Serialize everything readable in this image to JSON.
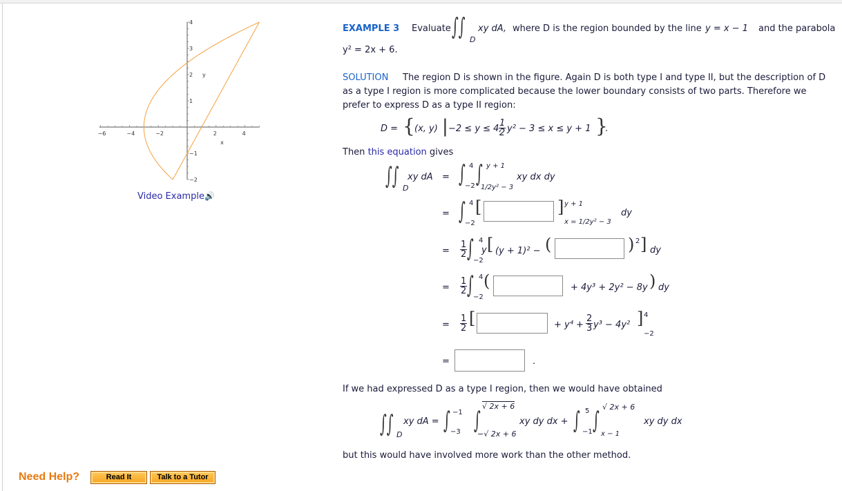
{
  "example": {
    "heading": "EXAMPLE 3",
    "evaluate": "Evaluate",
    "integrand": "xy dA,",
    "region_sub": "D",
    "statement": "where D is the region bounded by the line",
    "line_eq": "y = x − 1",
    "and_parabola": "and the parabola",
    "parabola_eq": "y² = 2x + 6."
  },
  "solution": {
    "heading": "SOLUTION",
    "lines": [
      "The region D is shown in the figure. Again D is both type I and type II, but the description of D",
      "as a type I region is more complicated because the lower boundary consists of two parts. Therefore we",
      "prefer to express D as a type II region:"
    ],
    "set_def": {
      "lhs": "D =",
      "pair": "(x, y)",
      "y_range": "−2 ≤ y ≤ 4,",
      "frac_num": "1",
      "frac_den": "2",
      "x_range": "y² − 3 ≤ x ≤ y + 1",
      "period": "."
    },
    "then": "Then",
    "equation_link": "this equation",
    "gives": "gives"
  },
  "steps": {
    "lhs": "xy dA",
    "lhs_sub": "D",
    "eq": "=",
    "step1": {
      "outer_upper": "4",
      "outer_lower": "−2",
      "inner_upper": "y + 1",
      "inner_lower": "1/2y² − 3",
      "integrand": "xy dx dy"
    },
    "step2": {
      "upper": "4",
      "lower": "−2",
      "eval_upper": "y + 1",
      "eval_lower": "x = 1/2y² − 3",
      "diff": "dy",
      "answer": ""
    },
    "step3": {
      "coef_num": "1",
      "coef_den": "2",
      "upper": "4",
      "lower": "−2",
      "body": "y",
      "expr": "(y + 1)² −",
      "power": "2",
      "diff": "dy",
      "answer": ""
    },
    "step4": {
      "coef_num": "1",
      "coef_den": "2",
      "upper": "4",
      "lower": "−2",
      "rest": "+ 4y³ + 2y² − 8y",
      "diff": "dy",
      "answer": ""
    },
    "step5": {
      "coef_num": "1",
      "coef_den": "2",
      "rest_a": "+ y⁴ +",
      "frac_num": "2",
      "frac_den": "3",
      "rest_b": "y³ − 4y²",
      "upper": "4",
      "lower": "−2",
      "answer": ""
    },
    "step6": {
      "answer": "",
      "period": "."
    }
  },
  "type1": {
    "intro": "If we had expressed D as a type I region, then we would have obtained",
    "lhs": "xy dA =",
    "lhs_sub": "D",
    "int1": {
      "outer_upper": "−1",
      "outer_lower": "−3",
      "inner_upper": "√ 2x + 6",
      "inner_lower": "−√ 2x + 6",
      "integrand": "xy dy dx +"
    },
    "int2": {
      "outer_upper": "5",
      "outer_lower": "−1",
      "inner_upper": "√ 2x + 6",
      "inner_lower": "x − 1",
      "integrand": "xy dy dx"
    },
    "conclusion": "but this would have involved more work than the other method."
  },
  "figure": {
    "video_link": "Video Example",
    "speaker_icon": "speaker-icon"
  },
  "chart_data": {
    "type": "line",
    "title": "",
    "xlabel": "x",
    "ylabel": "y",
    "xlim": [
      -6,
      5
    ],
    "ylim": [
      -2,
      4
    ],
    "x_ticks": [
      "−6",
      "−4",
      "−2",
      "2",
      "4"
    ],
    "y_ticks": [
      "4",
      "3",
      "2",
      "1",
      "−1",
      "−2"
    ],
    "curve_color": "#f5a040",
    "series": [
      {
        "name": "parabola y² = 2x + 6",
        "equation": "x = y²/2 − 3",
        "y_range": [
          -2,
          4
        ]
      },
      {
        "name": "line y = x − 1",
        "points": [
          [
            -1,
            -2
          ],
          [
            5,
            4
          ]
        ]
      }
    ]
  },
  "help": {
    "label": "Need Help?",
    "read_it": "Read It",
    "talk_tutor": "Talk to a Tutor"
  }
}
